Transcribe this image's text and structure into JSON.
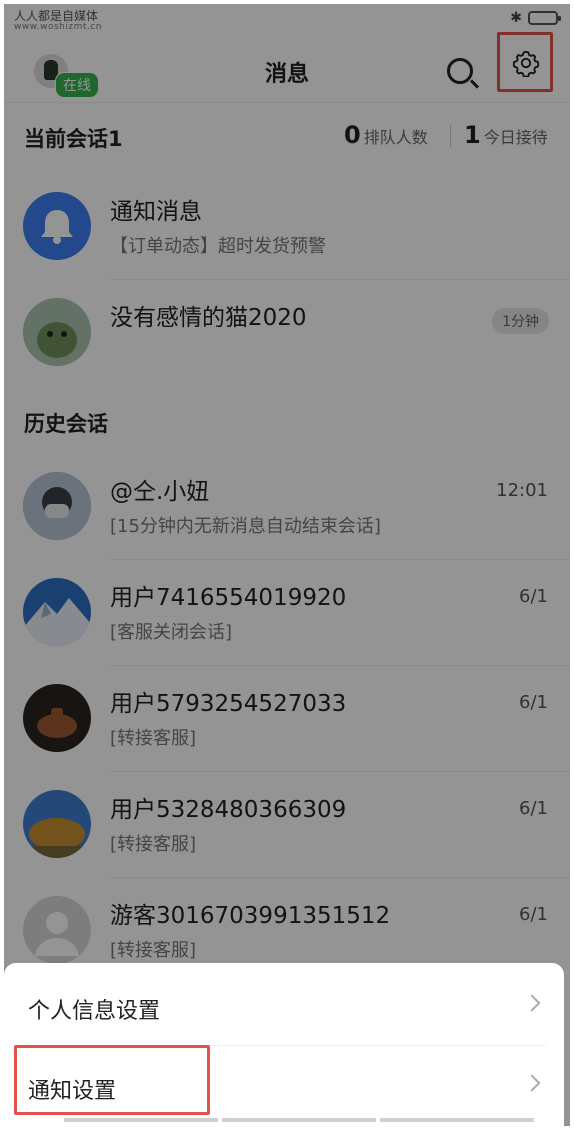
{
  "status": {
    "watermark_cn": "人人都是自媒体",
    "watermark_url": "www.woshizmt.cn"
  },
  "nav": {
    "title": "消息",
    "online_label": "在线"
  },
  "summary": {
    "current_label": "当前会话1",
    "queue_count": "0",
    "queue_label": "排队人数",
    "today_count": "1",
    "today_label": "今日接待"
  },
  "current_sessions": [
    {
      "name": "通知消息",
      "sub": "【订单动态】超时发货预警",
      "time": "",
      "pill": ""
    },
    {
      "name": "没有感情的猫2020",
      "sub": "",
      "time": "",
      "pill": "1分钟"
    }
  ],
  "history_header": "历史会话",
  "history": [
    {
      "name": "@仝.小妞",
      "sub": "[15分钟内无新消息自动结束会话]",
      "time": "12:01"
    },
    {
      "name": "用户7416554019920",
      "sub": "[客服关闭会话]",
      "time": "6/1"
    },
    {
      "name": "用户5793254527033",
      "sub": "[转接客服]",
      "time": "6/1"
    },
    {
      "name": "用户5328480366309",
      "sub": "[转接客服]",
      "time": "6/1"
    },
    {
      "name": "游客3016703991351512",
      "sub": "[转接客服]",
      "time": "6/1"
    }
  ],
  "sheet": {
    "personal_settings": "个人信息设置",
    "notification_settings": "通知设置"
  },
  "colors": {
    "highlight": "#e5524e",
    "online": "#37b24d",
    "notify_avatar": "#3d7cf0"
  }
}
